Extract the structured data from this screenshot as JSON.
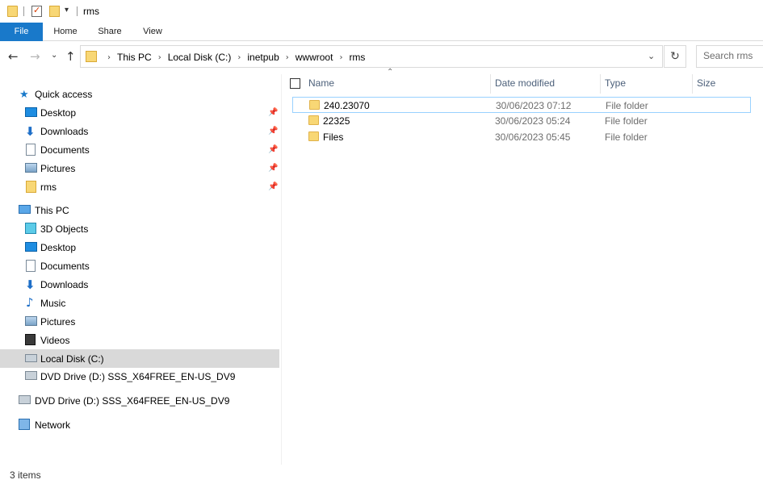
{
  "window": {
    "title": "rms"
  },
  "ribbon": {
    "tabs": [
      "File",
      "Home",
      "Share",
      "View"
    ]
  },
  "address": {
    "crumbs": [
      "This PC",
      "Local Disk (C:)",
      "inetpub",
      "wwwroot",
      "rms"
    ]
  },
  "search": {
    "placeholder": "Search rms"
  },
  "navpane": {
    "quick_access": {
      "label": "Quick access",
      "items": [
        {
          "label": "Desktop",
          "icon": "desktop-icon",
          "pinned": true
        },
        {
          "label": "Downloads",
          "icon": "downloads-icon",
          "pinned": true
        },
        {
          "label": "Documents",
          "icon": "documents-icon",
          "pinned": true
        },
        {
          "label": "Pictures",
          "icon": "pictures-icon",
          "pinned": true
        },
        {
          "label": "rms",
          "icon": "folder-icon",
          "pinned": true
        }
      ]
    },
    "this_pc": {
      "label": "This PC",
      "items": [
        {
          "label": "3D Objects",
          "icon": "3d-objects-icon"
        },
        {
          "label": "Desktop",
          "icon": "desktop-icon"
        },
        {
          "label": "Documents",
          "icon": "documents-icon"
        },
        {
          "label": "Downloads",
          "icon": "downloads-icon"
        },
        {
          "label": "Music",
          "icon": "music-icon"
        },
        {
          "label": "Pictures",
          "icon": "pictures-icon"
        },
        {
          "label": "Videos",
          "icon": "videos-icon"
        },
        {
          "label": "Local Disk (C:)",
          "icon": "local-disk-icon",
          "selected": true
        },
        {
          "label": "DVD Drive (D:) SSS_X64FREE_EN-US_DV9",
          "icon": "dvd-drive-icon"
        }
      ]
    },
    "dvd_root": {
      "label": "DVD Drive (D:) SSS_X64FREE_EN-US_DV9"
    },
    "network": {
      "label": "Network"
    }
  },
  "filelist": {
    "columns": [
      "Name",
      "Date modified",
      "Type",
      "Size"
    ],
    "rows": [
      {
        "name": "240.23070",
        "date": "30/06/2023 07:12",
        "type": "File folder",
        "size": ""
      },
      {
        "name": "22325",
        "date": "30/06/2023 05:24",
        "type": "File folder",
        "size": ""
      },
      {
        "name": "Files",
        "date": "30/06/2023 05:45",
        "type": "File folder",
        "size": ""
      }
    ]
  },
  "status": {
    "item_count": "3 items"
  },
  "colors": {
    "accent": "#1979ca",
    "folder": "#f8d775",
    "selection": "#d9d9d9",
    "focus_border": "#99d1ff"
  }
}
